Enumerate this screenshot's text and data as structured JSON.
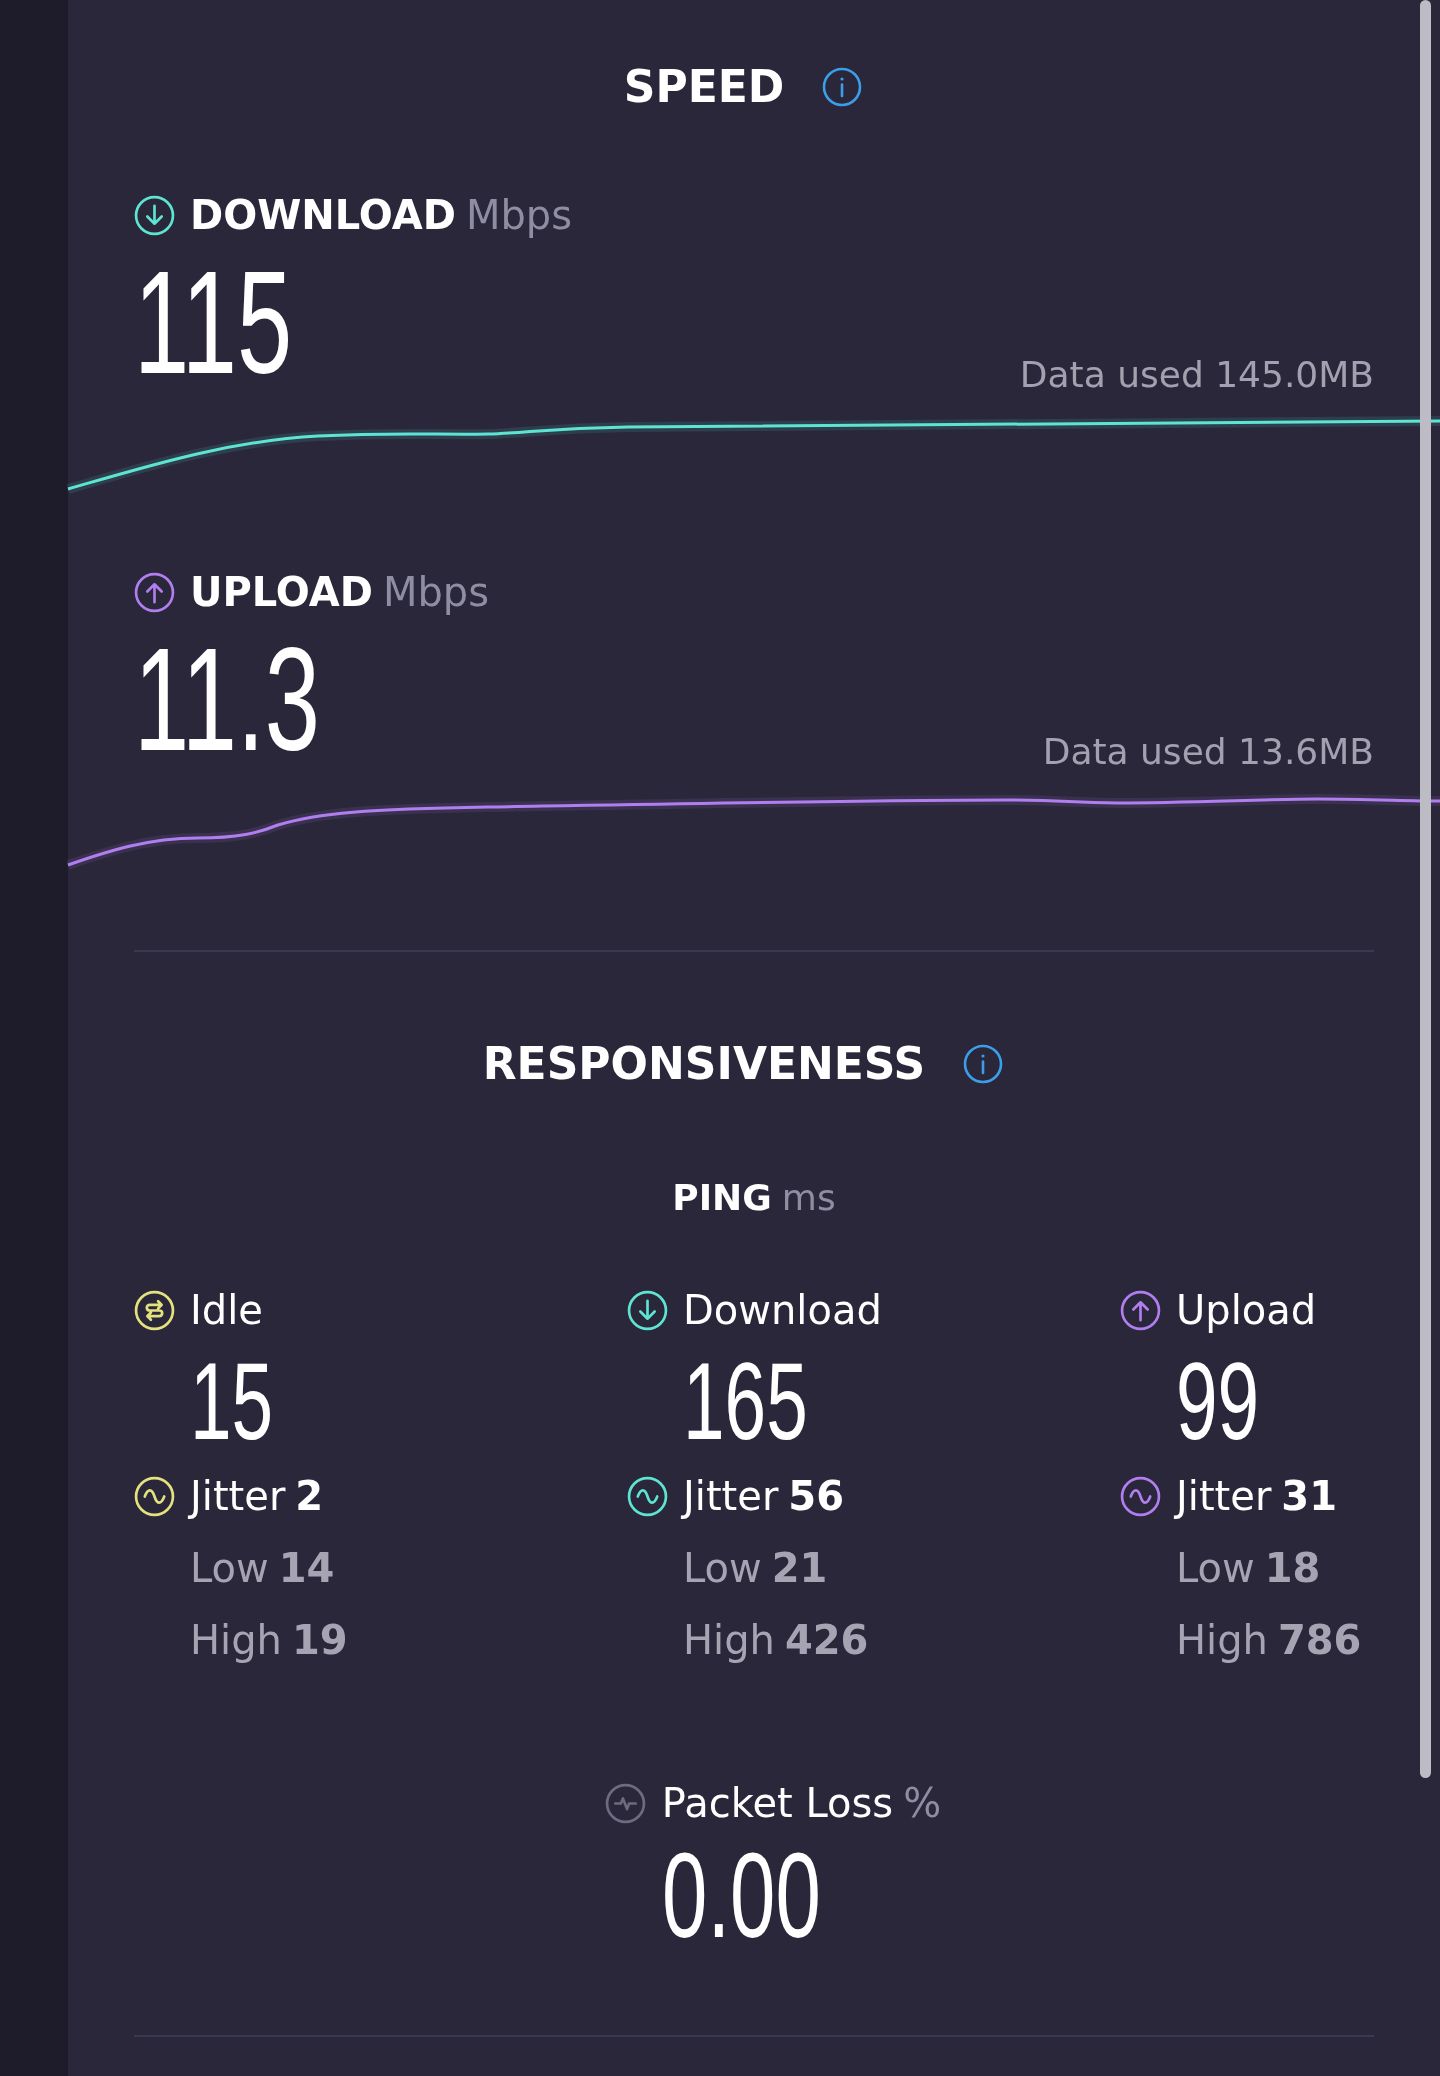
{
  "speed": {
    "title": "SPEED",
    "metrics": [
      {
        "kind": "download",
        "label": "DOWNLOAD",
        "unit": "Mbps",
        "value": "115",
        "data_used": "Data used 145.0MB",
        "color": "#5ee4d2"
      },
      {
        "kind": "upload",
        "label": "UPLOAD",
        "unit": "Mbps",
        "value": "11.3",
        "data_used": "Data used 13.6MB",
        "color": "#b17ef0"
      }
    ]
  },
  "responsiveness": {
    "title": "RESPONSIVENESS",
    "ping": {
      "label": "PING",
      "unit": "ms",
      "columns": [
        {
          "kind": "idle",
          "label": "Idle",
          "value": "15",
          "color": "#e4e27f",
          "jitter_label": "Jitter",
          "jitter": "2",
          "low_label": "Low",
          "low": "14",
          "high_label": "High",
          "high": "19"
        },
        {
          "kind": "download",
          "label": "Download",
          "value": "165",
          "color": "#5ee4d2",
          "jitter_label": "Jitter",
          "jitter": "56",
          "low_label": "Low",
          "low": "21",
          "high_label": "High",
          "high": "426"
        },
        {
          "kind": "upload",
          "label": "Upload",
          "value": "99",
          "color": "#b17ef0",
          "jitter_label": "Jitter",
          "jitter": "31",
          "low_label": "Low",
          "low": "18",
          "high_label": "High",
          "high": "786"
        }
      ]
    },
    "packet_loss": {
      "label": "Packet Loss",
      "unit": "%",
      "value": "0.00"
    }
  }
}
